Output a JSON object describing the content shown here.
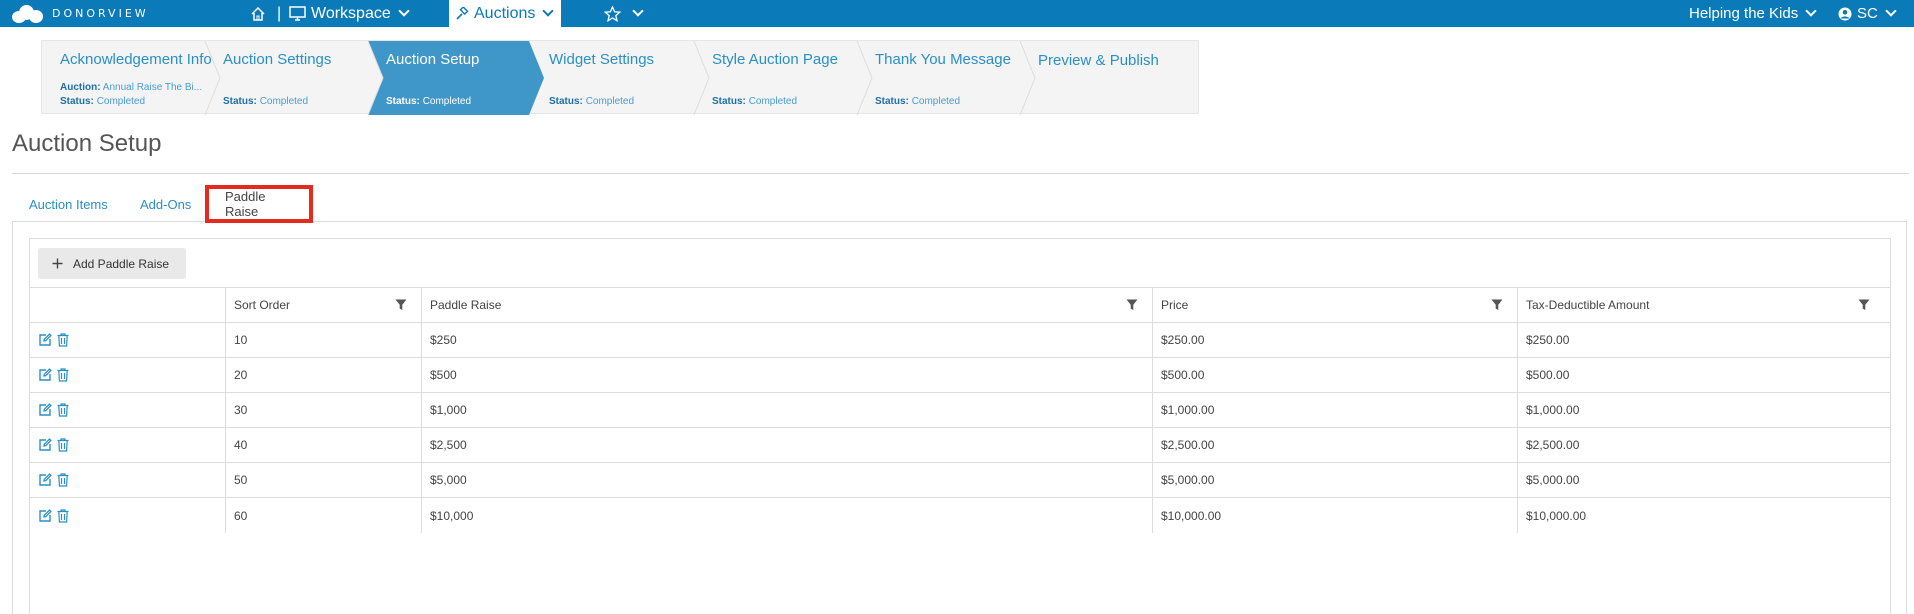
{
  "brand": {
    "name": "DONORVIEW"
  },
  "nav": {
    "workspace_label": "Workspace",
    "auctions_label": "Auctions",
    "org_label": "Helping the Kids",
    "user_initials": "SC"
  },
  "wizard": {
    "steps": [
      {
        "title": "Acknowledgement Info",
        "auction_label": "Auction:",
        "auction_value": "Annual Raise The Bi...",
        "status_label": "Status:",
        "status_value": "Completed"
      },
      {
        "title": "Auction Settings",
        "status_label": "Status:",
        "status_value": "Completed"
      },
      {
        "title": "Auction Setup",
        "status_label": "Status:",
        "status_value": "Completed"
      },
      {
        "title": "Widget Settings",
        "status_label": "Status:",
        "status_value": "Completed"
      },
      {
        "title": "Style Auction Page",
        "status_label": "Status:",
        "status_value": "Completed"
      },
      {
        "title": "Thank You Message",
        "status_label": "Status:",
        "status_value": "Completed"
      },
      {
        "title": "Preview & Publish"
      }
    ]
  },
  "page": {
    "title": "Auction Setup"
  },
  "tabs": [
    {
      "label": "Auction Items"
    },
    {
      "label": "Add-Ons"
    },
    {
      "label": "Paddle Raise"
    }
  ],
  "toolbar": {
    "add_label": "Add Paddle Raise"
  },
  "table": {
    "columns": [
      "Sort Order",
      "Paddle Raise",
      "Price",
      "Tax-Deductible Amount"
    ],
    "rows": [
      {
        "sort": "10",
        "raise": "$250",
        "price": "$250.00",
        "tax": "$250.00"
      },
      {
        "sort": "20",
        "raise": "$500",
        "price": "$500.00",
        "tax": "$500.00"
      },
      {
        "sort": "30",
        "raise": "$1,000",
        "price": "$1,000.00",
        "tax": "$1,000.00"
      },
      {
        "sort": "40",
        "raise": "$2,500",
        "price": "$2,500.00",
        "tax": "$2,500.00"
      },
      {
        "sort": "50",
        "raise": "$5,000",
        "price": "$5,000.00",
        "tax": "$5,000.00"
      },
      {
        "sort": "60",
        "raise": "$10,000",
        "price": "$10,000.00",
        "tax": "$10,000.00"
      }
    ]
  },
  "colors": {
    "brand": "#0a7ab8",
    "active_step": "#3f96c8",
    "link": "#2a8fc6",
    "highlight": "#e52b1e"
  }
}
